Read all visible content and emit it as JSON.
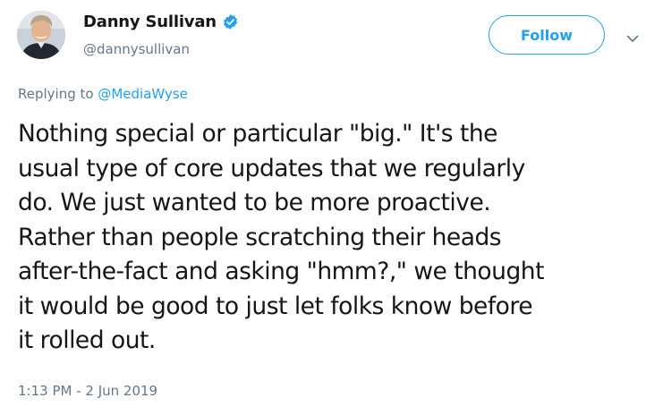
{
  "author": {
    "display_name": "Danny Sullivan",
    "handle": "@dannysullivan",
    "verified": true
  },
  "follow_button_label": "Follow",
  "reply_context": {
    "prefix": "Replying to ",
    "mention": "@MediaWyse"
  },
  "tweet_text": "Nothing special or particular \"big.\" It's the\nusual type of core updates that we regularly\ndo. We just wanted to be more proactive.\nRather than people scratching their heads\nafter-the-fact and asking \"hmm?,\" we thought\nit would be good to just let folks know before\nit rolled out.",
  "timestamp": "1:13 PM - 2 Jun 2019",
  "icons": [
    "verified-badge-icon",
    "chevron-down-icon"
  ],
  "colors": {
    "accent": "#1da1f2",
    "text": "#14171a",
    "secondary": "#657786"
  }
}
